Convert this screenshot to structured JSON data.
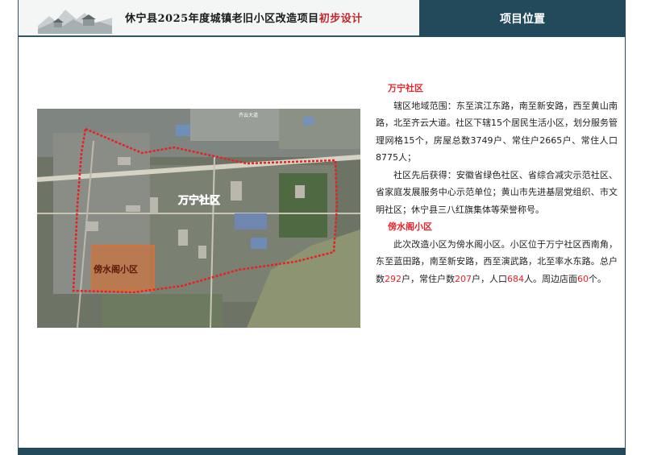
{
  "header": {
    "title_main": "休宁县2025年度城镇老旧小区改造项目",
    "title_highlight": "初步设计",
    "section_label": "项目位置"
  },
  "map": {
    "label_community": "万宁社区",
    "label_subarea": "傍水阁小区",
    "road_label": "齐云大道"
  },
  "content": {
    "section1_title": "万宁社区",
    "section1_para1": "辖区地域范围：东至滨江东路，南至新安路，西至黄山南路，北至齐云大道。社区下辖15个居民生活小区，划分服务管理网格15个，房屋总数3749户、常住户2665户、常住人口8775人；",
    "section1_para2": "社区先后获得：安徽省绿色社区、省综合减灾示范社区、省家庭发展服务中心示范单位；黄山市先进基层党组织、市文明社区；休宁县三八红旗集体等荣誉称号。",
    "section2_title": "傍水阁小区",
    "section2_para_a": "此次改造小区为傍水阁小区。小区位于万宁社区西南角，东至蓝田路，南至新安路，西至演武路，北至率水东路。总户数",
    "households_total": "292",
    "section2_para_b": "户，常住户数",
    "households_resident": "207",
    "section2_para_c": "户，人口",
    "population": "684",
    "section2_para_d": "人。周边店面",
    "shops": "60",
    "section2_para_e": "个。"
  },
  "colors": {
    "header_dark": "#234a5a",
    "accent_red": "#e8232b",
    "label_purple": "#a020c0"
  }
}
